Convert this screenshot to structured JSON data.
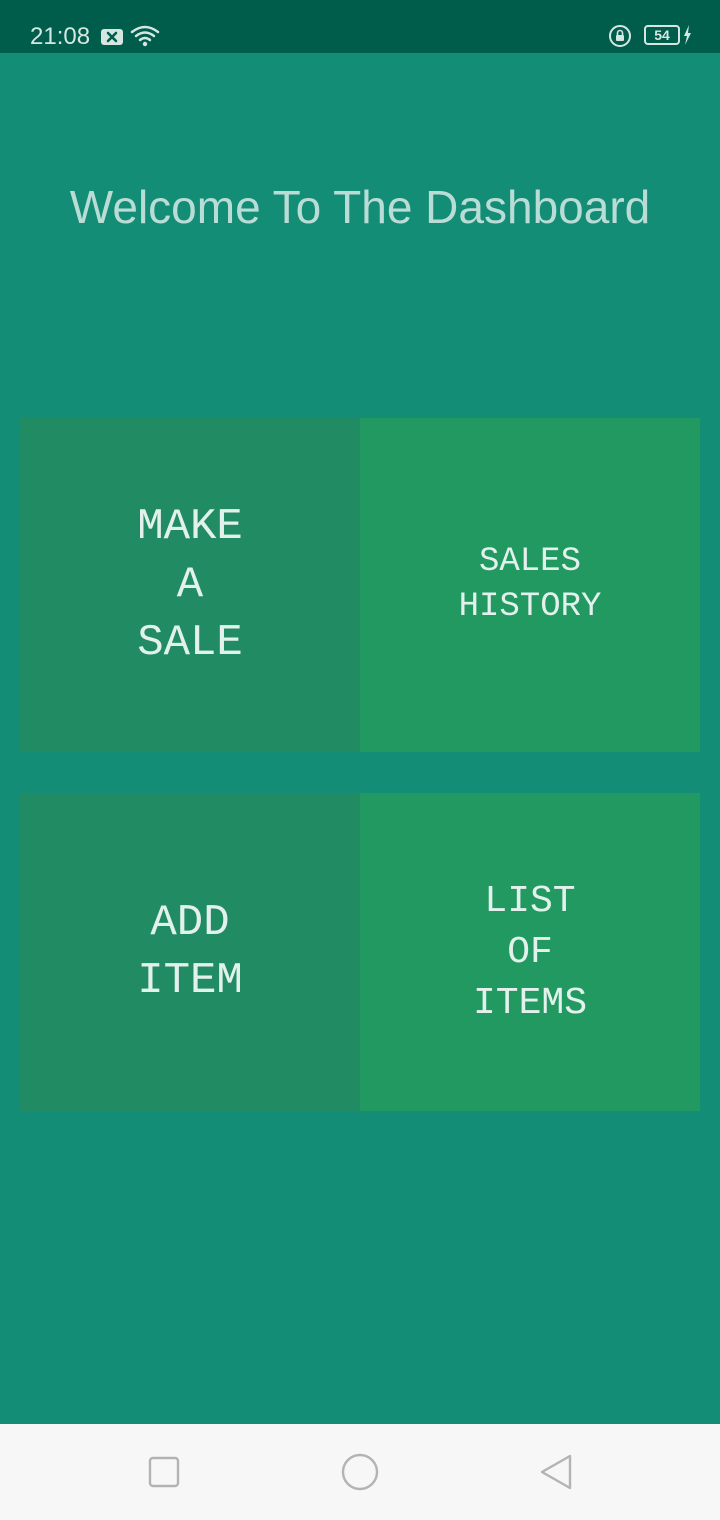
{
  "status_bar": {
    "time": "21:08",
    "battery_level": "54",
    "icons": [
      "notification-x-icon",
      "wifi-icon",
      "rotation-lock-icon",
      "battery-icon",
      "charging-bolt-icon"
    ]
  },
  "header": {
    "title": "Welcome To The Dashboard"
  },
  "dashboard": {
    "tiles": [
      {
        "lines": [
          "MAKE",
          "A",
          "SALE"
        ]
      },
      {
        "lines": [
          "SALES",
          "HISTORY"
        ]
      },
      {
        "lines": [
          "ADD",
          "ITEM"
        ]
      },
      {
        "lines": [
          "LIST",
          "OF",
          "ITEMS"
        ]
      }
    ]
  },
  "nav_bar": {
    "buttons": [
      "recents-square-icon",
      "home-circle-icon",
      "back-triangle-icon"
    ]
  },
  "colors": {
    "background": "#138d75",
    "status_bar": "#005d4c",
    "tile_left": "#218c63",
    "tile_right": "#239962",
    "nav_bar": "#f7f7f7"
  }
}
